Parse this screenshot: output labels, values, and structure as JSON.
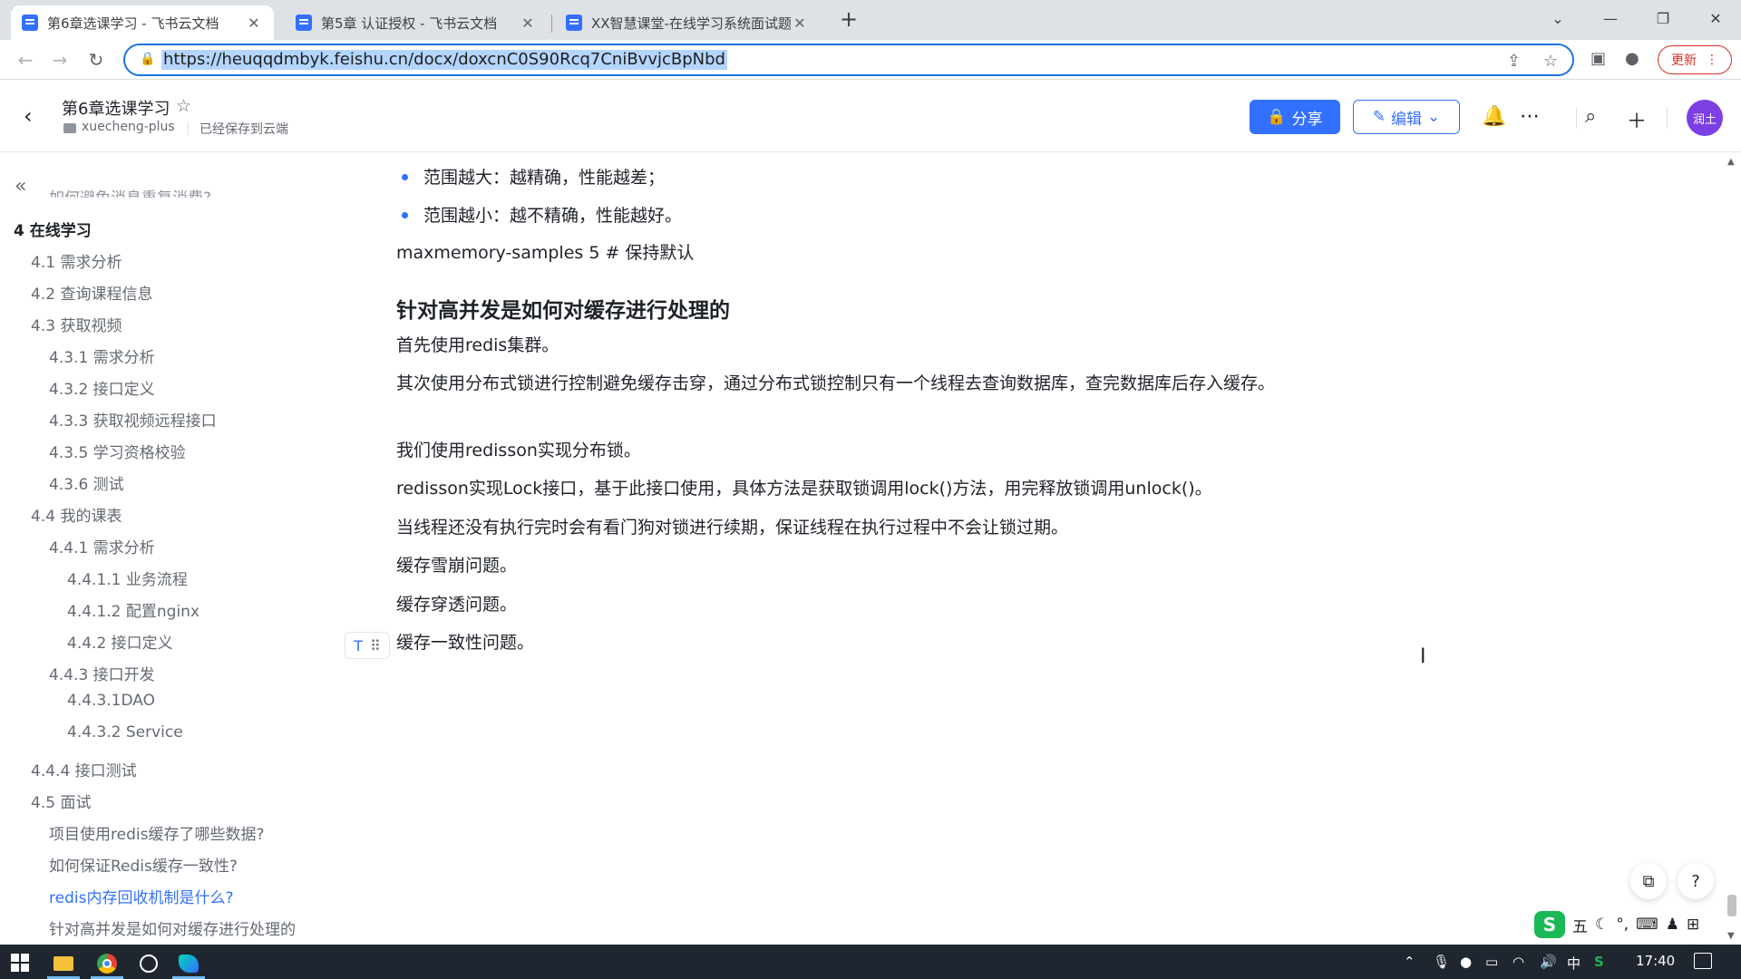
{
  "browser": {
    "tabs": [
      {
        "title": "第6章选课学习 - 飞书云文档",
        "active": true
      },
      {
        "title": "第5章 认证授权 - 飞书云文档",
        "active": false
      },
      {
        "title": "XX智慧课堂-在线学习系统面试题",
        "active": false
      }
    ],
    "new_tab": "+",
    "close_glyph": "✕",
    "url": "https://heuqqdmbyk.feishu.cn/docx/doxcnC0S90Rcq7CniBvvjcBpNbd",
    "update_label": "更新",
    "menu_glyph": "⋮"
  },
  "doc": {
    "title": "第6章选课学习",
    "folder": "xuecheng-plus",
    "save_status": "已经保存到云端",
    "share_label": "分享",
    "edit_label": "编辑",
    "avatar_text": "润土"
  },
  "outline": {
    "items": [
      {
        "text": "如何避免消息重复消费?",
        "level": 2,
        "cut": true
      },
      {
        "text": "4 在线学习",
        "level": 0
      },
      {
        "text": "4.1 需求分析",
        "level": 1
      },
      {
        "text": "4.2 查询课程信息",
        "level": 1
      },
      {
        "text": "4.3 获取视频",
        "level": 1
      },
      {
        "text": "4.3.1 需求分析",
        "level": 2
      },
      {
        "text": "4.3.2 接口定义",
        "level": 2
      },
      {
        "text": "4.3.3 获取视频远程接口",
        "level": 2
      },
      {
        "text": "4.3.5 学习资格校验",
        "level": 2
      },
      {
        "text": "4.3.6 测试",
        "level": 2
      },
      {
        "text": "4.4 我的课表",
        "level": 1
      },
      {
        "text": "4.4.1 需求分析",
        "level": 2
      },
      {
        "text": "4.4.1.1 业务流程",
        "level": 3
      },
      {
        "text": "4.4.1.2 配置nginx",
        "level": 3
      },
      {
        "text": "4.4.2 接口定义",
        "level": 3
      },
      {
        "text": "4.4.3 接口开发",
        "level": 2
      },
      {
        "text": "4.4.3.1DAO",
        "level": 3
      },
      {
        "text": "4.4.3.2 Service",
        "level": 3
      },
      {
        "text": "4.4.4 接口测试",
        "level": 1
      },
      {
        "text": "4.5 面试",
        "level": 1
      },
      {
        "text": "项目使用redis缓存了哪些数据?",
        "level": 2
      },
      {
        "text": "如何保证Redis缓存一致性?",
        "level": 2
      },
      {
        "text": "redis内存回收机制是什么?",
        "level": 2,
        "active": true
      },
      {
        "text": "针对高并发是如何对缓存进行处理的",
        "level": 2
      }
    ]
  },
  "content": {
    "bullets": [
      "范围越大：越精确，性能越差；",
      "范围越小：越不精确，性能越好。"
    ],
    "code_line": "maxmemory-samples 5 # 保持默认",
    "heading": "针对高并发是如何对缓存进行处理的",
    "paragraphs": [
      "首先使用redis集群。",
      "其次使用分布式锁进行控制避免缓存击穿，通过分布式锁控制只有一个线程去查询数据库，查完数据库后存入缓存。",
      "我们使用redisson实现分布锁。",
      "redisson实现Lock接口，基于此接口使用，具体方法是获取锁调用lock()方法，用完释放锁调用unlock()。",
      "当线程还没有执行完时会有看门狗对锁进行续期，保证线程在执行过程中不会让锁过期。",
      "缓存雪崩问题。",
      "缓存穿透问题。",
      "缓存一致性问题。"
    ]
  },
  "ime": {
    "mode": "五"
  },
  "taskbar": {
    "clock": "17:40",
    "ime_lang": "中"
  },
  "colors": {
    "accent": "#3370ff",
    "avatar": "#7b3fe4",
    "update": "#d93025"
  }
}
